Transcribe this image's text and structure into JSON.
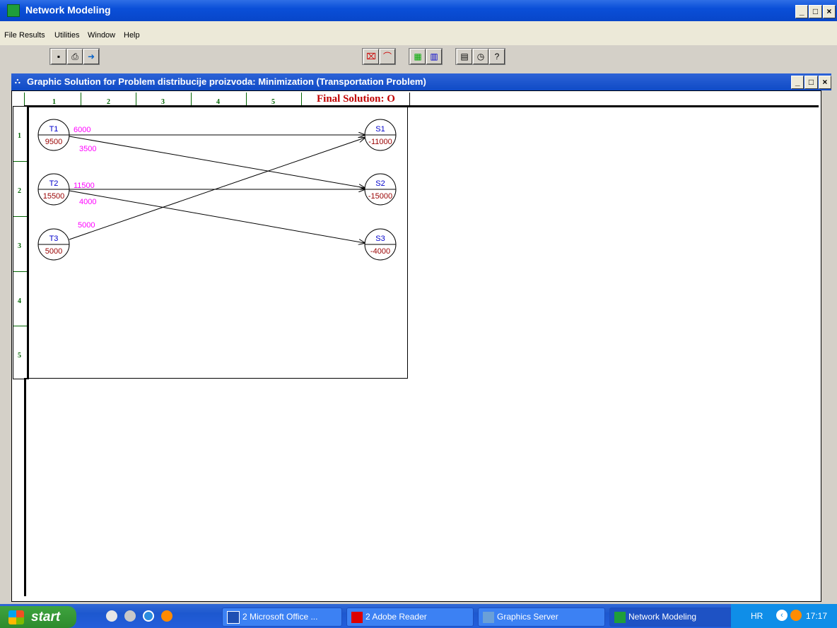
{
  "app": {
    "title": "Network Modeling"
  },
  "menu": [
    "File",
    "Results",
    "Utilities",
    "Window",
    "Help"
  ],
  "inner_window": {
    "title": "Graphic Solution for Problem distribucije proizvoda: Minimization (Transportation Problem)"
  },
  "grid": {
    "columns": [
      "1",
      "2",
      "3",
      "4",
      "5"
    ],
    "rows": [
      "1",
      "2",
      "3",
      "4",
      "5"
    ],
    "final_label": "Final Solution: O"
  },
  "network": {
    "sources": [
      {
        "name": "T1",
        "value": "9500"
      },
      {
        "name": "T2",
        "value": "15500"
      },
      {
        "name": "T3",
        "value": "5000"
      }
    ],
    "sinks": [
      {
        "name": "S1",
        "value": "-11000"
      },
      {
        "name": "S2",
        "value": "-15000"
      },
      {
        "name": "S3",
        "value": "-4000"
      }
    ],
    "flows": [
      {
        "from": "T1",
        "to": "S1",
        "amount": "6000"
      },
      {
        "from": "T1",
        "to": "S2",
        "amount": "3500"
      },
      {
        "from": "T2",
        "to": "S2",
        "amount": "11500"
      },
      {
        "from": "T2",
        "to": "S3",
        "amount": "4000"
      },
      {
        "from": "T3",
        "to": "S1",
        "amount": "5000"
      }
    ],
    "colors": {
      "node_name": "#0000cc",
      "node_value": "#990000",
      "flow_label": "#ff00ff",
      "ruler": "#006400"
    }
  },
  "taskbar": {
    "start": "start",
    "tasks": [
      "2 Microsoft Office ...",
      "2 Adobe Reader",
      "Graphics Server",
      "Network Modeling"
    ],
    "language": "HR",
    "clock": "17:17"
  }
}
